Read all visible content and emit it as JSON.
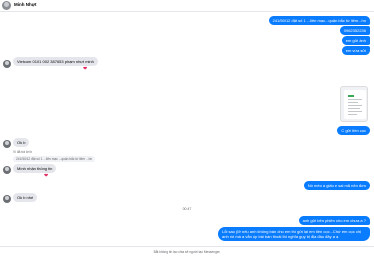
{
  "header": {
    "contact_name": "Minh Nhựt"
  },
  "messages": {
    "out_1": "241/50/12 đặt số 1 ...liên mạc...quận bắc từ liêm...hn",
    "out_2": "0962352236",
    "out_3": "em gửi ảnh",
    "out_4": "em vừa sửi",
    "in_bank": "Vietcom 0101 002 387653 phạm nhựt minh",
    "out_image_caption": "C gửi tiền cọc",
    "in_ok": "Ok b",
    "reply_header": "Vì đã trả lời b",
    "reply_quote": "241/50/12 đặt số 1 ...liên mạc ...quận bắc từ liêm ...hn",
    "in_confirm": "Mình nhận thông tin",
    "out_ask": "Nó mèo a giấu e sai mã nên đơn",
    "in_ok2": "Ok b nhé",
    "time_separator": "00:47",
    "out_paid": "anh gửi bên phiên cho em chưa a ?",
    "out_long": "Lỗi sao (lỡ nếu anh không bán cho em thì gửi lại em tiền cọc...Chứ em cọc chị anh rồi mà a vẫn úp bài bán thoải thì nghĩa gụy bị địa đầu đây ạ ạ"
  },
  "footer": {
    "notice": "Bắt không tin lao chia sẻ người tạo Messenger."
  },
  "colors": {
    "outgoing": "#0a7cff",
    "incoming": "#e4e6eb",
    "reaction": "#e0245e"
  }
}
